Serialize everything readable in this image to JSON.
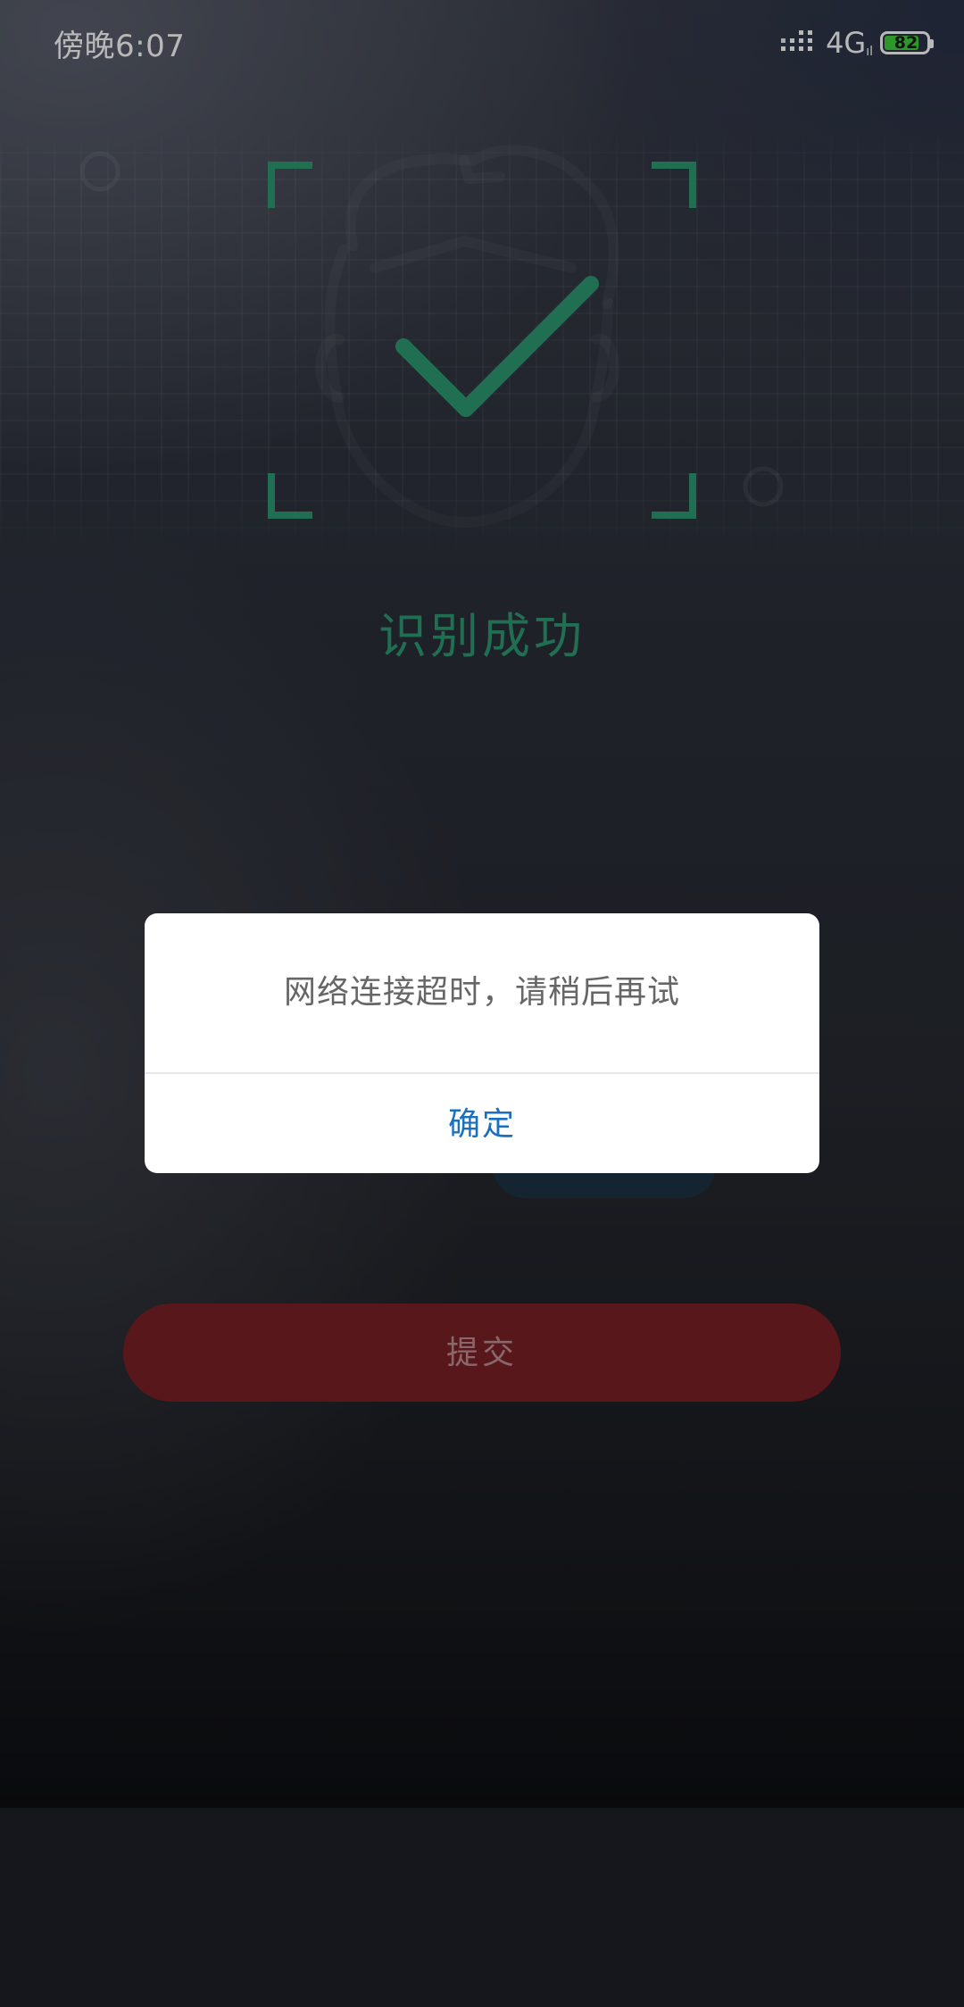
{
  "status_bar": {
    "time": "傍晚6:07",
    "network": "4G",
    "network_sub": "ıl",
    "battery_level": "82",
    "battery_fraction": 0.82
  },
  "recognition": {
    "status_text": "识别成功",
    "accent_color": "#2e9a72",
    "icon": "face-check-icon"
  },
  "submit": {
    "label": "提交",
    "color": "#7b2126"
  },
  "dialog": {
    "message": "网络连接超时，请稍后再试",
    "confirm_label": "确定",
    "confirm_color": "#1a6fc0"
  }
}
